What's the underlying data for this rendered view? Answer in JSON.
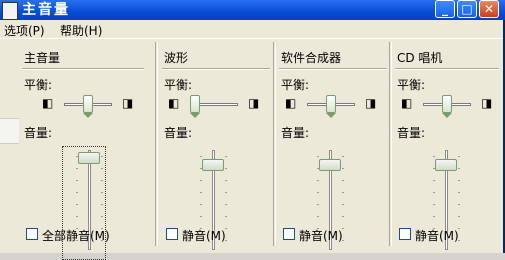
{
  "title": "主音量",
  "menu": [
    "选项(P)",
    "帮助(H)"
  ],
  "columns": [
    {
      "name": "主音量",
      "balance_label": "平衡:",
      "volume_label": "音量:",
      "mute_label": "全部静音(M)",
      "balance": 0.5,
      "volume": 0.98,
      "muted": false
    },
    {
      "name": "波形",
      "balance_label": "平衡:",
      "volume_label": "音量:",
      "mute_label": "静音(M)",
      "balance": 0.0,
      "volume": 0.9,
      "muted": false
    },
    {
      "name": "软件合成器",
      "balance_label": "平衡:",
      "volume_label": "音量:",
      "mute_label": "静音(M)",
      "balance": 0.5,
      "volume": 0.9,
      "muted": false
    },
    {
      "name": "CD 唱机",
      "balance_label": "平衡:",
      "volume_label": "音量:",
      "mute_label": "静音(M)",
      "balance": 0.5,
      "volume": 0.9,
      "muted": false
    }
  ],
  "colors": {
    "title_bar": "#0a4fd6",
    "window_bg": "#ece9d8",
    "slider_thumb": "#d8e4d0"
  }
}
